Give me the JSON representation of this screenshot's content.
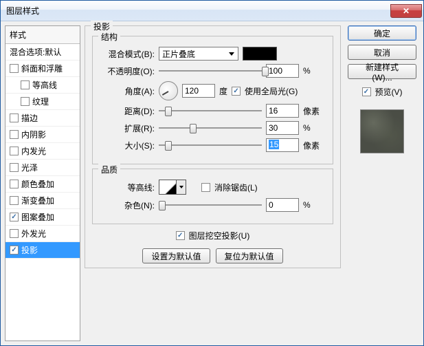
{
  "window": {
    "title": "图层样式"
  },
  "styles": {
    "header": "样式",
    "items": [
      {
        "label": "混合选项:默认",
        "checked": null
      },
      {
        "label": "斜面和浮雕",
        "checked": false
      },
      {
        "label": "等高线",
        "checked": false
      },
      {
        "label": "纹理",
        "checked": false
      },
      {
        "label": "描边",
        "checked": false
      },
      {
        "label": "内阴影",
        "checked": false
      },
      {
        "label": "内发光",
        "checked": false
      },
      {
        "label": "光泽",
        "checked": false
      },
      {
        "label": "颜色叠加",
        "checked": false
      },
      {
        "label": "渐变叠加",
        "checked": false
      },
      {
        "label": "图案叠加",
        "checked": true
      },
      {
        "label": "外发光",
        "checked": false
      },
      {
        "label": "投影",
        "checked": true,
        "selected": true
      }
    ]
  },
  "main": {
    "section_title": "投影",
    "structure": {
      "title": "结构",
      "blend_mode_label": "混合模式(B):",
      "blend_mode_value": "正片叠底",
      "color": "#000000",
      "opacity_label": "不透明度(O):",
      "opacity_value": "100",
      "percent": "%",
      "angle_label": "角度(A):",
      "angle_value": "120",
      "degree": "度",
      "global_light": "使用全局光(G)",
      "global_light_checked": true,
      "distance_label": "距离(D):",
      "distance_value": "16",
      "px": "像素",
      "spread_label": "扩展(R):",
      "spread_value": "30",
      "size_label": "大小(S):",
      "size_value": "15"
    },
    "quality": {
      "title": "品质",
      "contour_label": "等高线:",
      "antialias": "消除锯齿(L)",
      "antialias_checked": false,
      "noise_label": "杂色(N):",
      "noise_value": "0"
    },
    "knockout_label": "图层挖空投影(U)",
    "knockout_checked": true,
    "make_default": "设置为默认值",
    "reset_default": "复位为默认值"
  },
  "right": {
    "ok": "确定",
    "cancel": "取消",
    "new_style": "新建样式(W)...",
    "preview": "预览(V)",
    "preview_checked": true
  }
}
